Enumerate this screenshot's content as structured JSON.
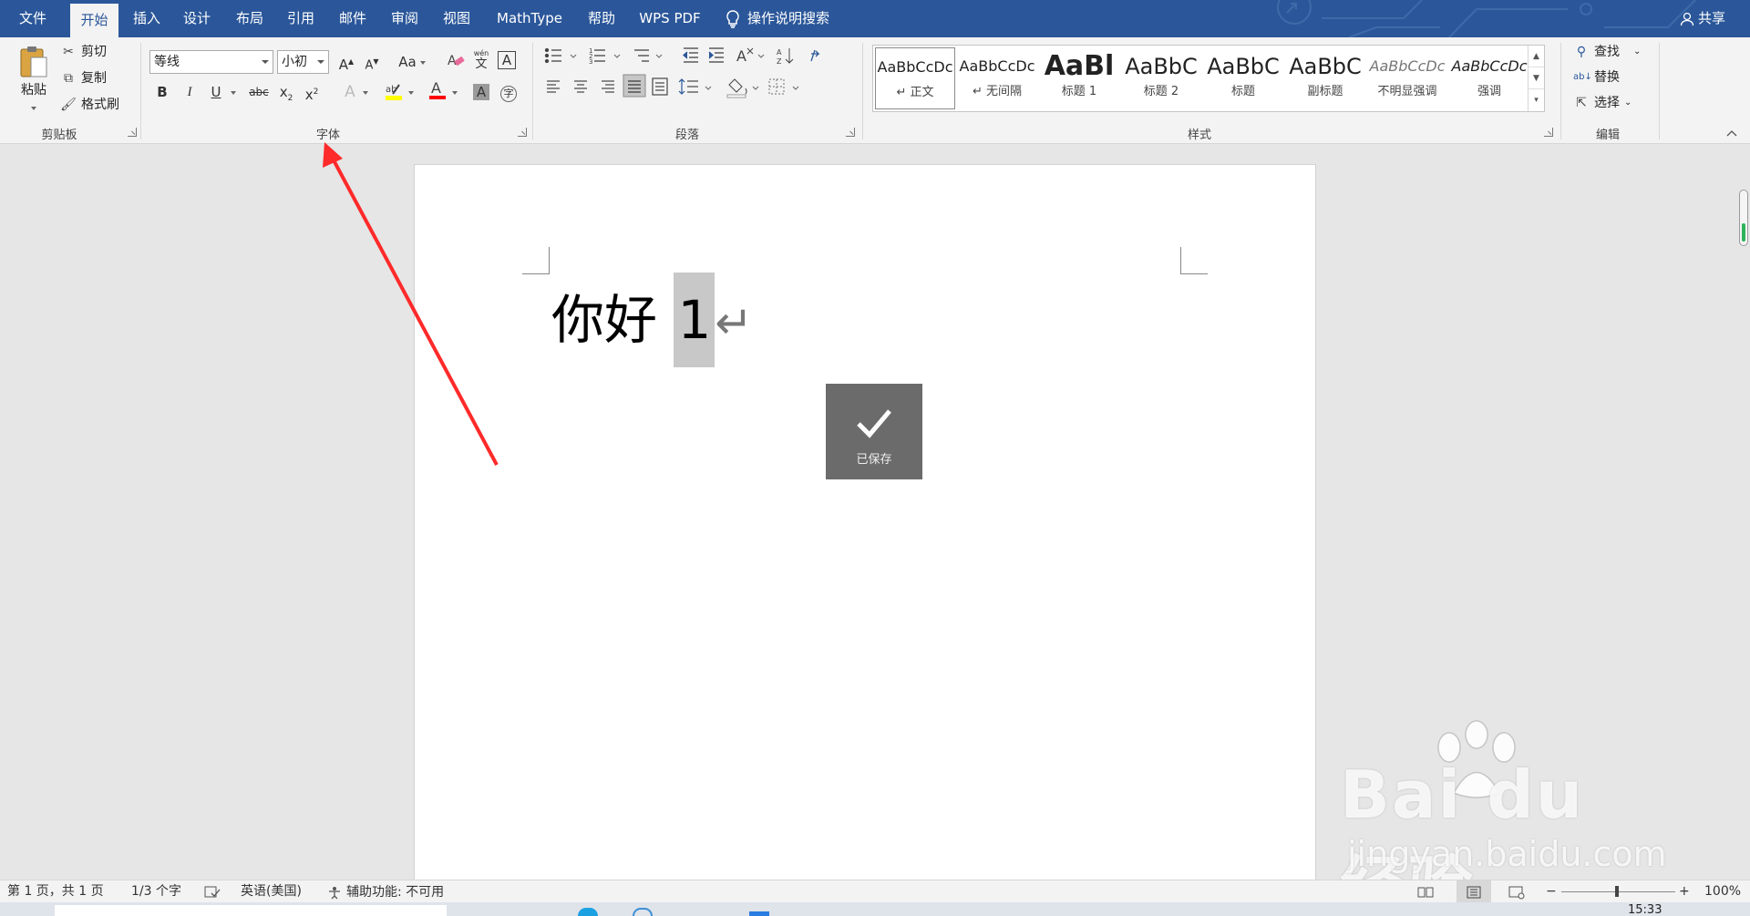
{
  "tabs": {
    "file": "文件",
    "home": "开始",
    "insert": "插入",
    "design": "设计",
    "layout": "布局",
    "references": "引用",
    "mailings": "邮件",
    "review": "审阅",
    "view": "视图",
    "mathtype": "MathType",
    "help": "帮助",
    "wpspdf": "WPS PDF",
    "tell_me": "操作说明搜索",
    "share": "共享"
  },
  "clipboard": {
    "paste": "粘贴",
    "cut": "剪切",
    "copy": "复制",
    "format_painter": "格式刷",
    "label": "剪贴板"
  },
  "font": {
    "name": "等线",
    "size": "小初",
    "case_label": "Aa",
    "label": "字体",
    "pinyin_top": "wén",
    "pinyin_char": "文"
  },
  "paragraph": {
    "label": "段落"
  },
  "styles": {
    "label": "样式",
    "items": [
      {
        "preview": "AaBbCcDc",
        "name": "↵ 正文"
      },
      {
        "preview": "AaBbCcDc",
        "name": "↵ 无间隔"
      },
      {
        "preview": "AaBl",
        "name": "标题 1"
      },
      {
        "preview": "AaBbC",
        "name": "标题 2"
      },
      {
        "preview": "AaBbC",
        "name": "标题"
      },
      {
        "preview": "AaBbC",
        "name": "副标题"
      },
      {
        "preview": "AaBbCcDc",
        "name": "不明显强调"
      },
      {
        "preview": "AaBbCcDc",
        "name": "强调"
      }
    ]
  },
  "editing": {
    "find": "查找",
    "replace": "替换",
    "select": "选择",
    "label": "编辑"
  },
  "document": {
    "text_before": "你好 ",
    "selected": "1",
    "para_mark": "↵"
  },
  "toast": {
    "text": "已保存"
  },
  "status": {
    "page": "第 1 页，共 1 页",
    "words": "1/3 个字",
    "language": "英语(美国)",
    "accessibility": "辅助功能: 不可用",
    "zoom": "100%",
    "zoom_minus": "−",
    "zoom_plus": "+"
  },
  "watermark": {
    "brand": "Bai du 经验",
    "site": "jingyan.baidu.com"
  },
  "taskbar": {
    "clock": "15:33"
  },
  "colors": {
    "accent": "#2b579a",
    "arrow": "#ff2a2a",
    "highlight": "#ffff00",
    "font_color": "#ff0000"
  }
}
